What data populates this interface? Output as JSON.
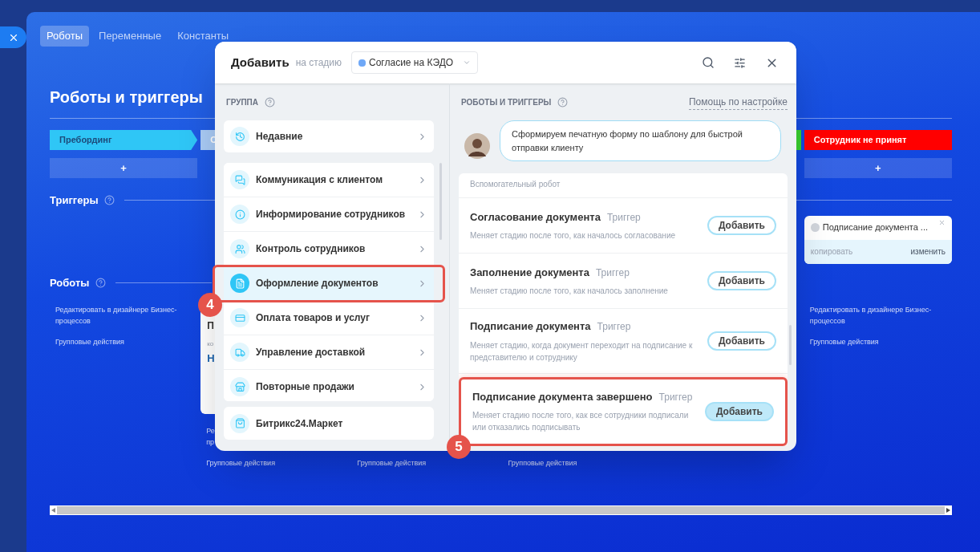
{
  "tabs": [
    {
      "label": "Роботы",
      "selected": true
    },
    {
      "label": "Переменные",
      "selected": false
    },
    {
      "label": "Константы",
      "selected": false
    }
  ],
  "page_title": "Роботы и триггеры",
  "triggers_heading": "Триггеры",
  "robots_heading": "Роботы",
  "columns": [
    {
      "kind": "plain",
      "stage": {
        "label": "Пребординг",
        "color": "#2fc6f6"
      },
      "add": "+",
      "links": [
        "Редактировать в дизайнере Бизнес-процессов",
        "Групповые действия"
      ]
    },
    {
      "kind": "card",
      "stage": {
        "label": "С",
        "color": "#a9cbf6"
      },
      "card": {
        "title": "П",
        "note": "ко",
        "link": "Н"
      },
      "links": [
        "Ре\nпр",
        "Групповые действия"
      ]
    },
    {
      "kind": "card",
      "links": [
        "Групповые действия"
      ]
    },
    {
      "kind": "card",
      "links": [
        "Групповые действия"
      ]
    },
    {
      "kind": "plain",
      "stage": {
        "color": "#39d12f"
      }
    },
    {
      "kind": "plain",
      "stage": {
        "label": "Сотрудник не принят",
        "color": "#ff0000"
      },
      "add": "+",
      "trigger": {
        "title": "Подписание документа ...",
        "copy": "копировать",
        "edit": "изменить"
      },
      "links": [
        "Редактировать в дизайнере Бизнес-процессов",
        "Групповые действия"
      ]
    }
  ],
  "dialog": {
    "title": "Добавить",
    "stage_prefix": "на стадию",
    "stage": {
      "label": "Согласие на КЭДО",
      "color": "#6fa8f7"
    },
    "group_heading": "ГРУППА",
    "groups": [
      {
        "kind": "recent",
        "label": "Недавние",
        "selected": false
      },
      {
        "kind": "list",
        "label": "Коммуникация с клиентом",
        "selected": false
      },
      {
        "kind": "list",
        "label": "Информирование сотрудников",
        "selected": false
      },
      {
        "kind": "list",
        "label": "Контроль сотрудников",
        "selected": false
      },
      {
        "kind": "list",
        "label": "Оформление документов",
        "selected": true
      },
      {
        "kind": "list",
        "label": "Оплата товаров и услуг",
        "selected": false
      },
      {
        "kind": "list",
        "label": "Управление доставкой",
        "selected": false
      },
      {
        "kind": "list",
        "label": "Повторные продажи",
        "selected": false
      },
      {
        "kind": "market",
        "label": "Битрикс24.Маркет",
        "selected": false
      }
    ],
    "right_heading": "РОБОТЫ И ТРИГГЕРЫ",
    "help_link": "Помощь по настройке",
    "hint": "Сформируем печатную форму по шаблону для быстрой отправки клиенту",
    "items": [
      {
        "kind": "partial",
        "description": "Вспомогательный робот"
      },
      {
        "kind": "trigger",
        "title": "Согласование документа",
        "type": "Триггер",
        "description": "Меняет стадию после того, как началось согласование",
        "button": "Добавить",
        "highlighted": false
      },
      {
        "kind": "trigger",
        "title": "Заполнение документа",
        "type": "Триггер",
        "description": "Меняет стадию после того, как началось заполнение",
        "button": "Добавить",
        "highlighted": false
      },
      {
        "kind": "trigger",
        "title": "Подписание документа",
        "type": "Триггер",
        "description": "Меняет стадию, когда документ переходит на подписание к представителю и сотруднику",
        "button": "Добавить",
        "highlighted": false
      },
      {
        "kind": "trigger",
        "title": "Подписание документа завершено",
        "type": "Триггер",
        "description": "Меняет стадию после того, как все сотрудники подписали или отказались подписывать",
        "button": "Добавить",
        "highlighted": true
      }
    ]
  },
  "callouts": [
    {
      "number": "4"
    },
    {
      "number": "5"
    }
  ]
}
